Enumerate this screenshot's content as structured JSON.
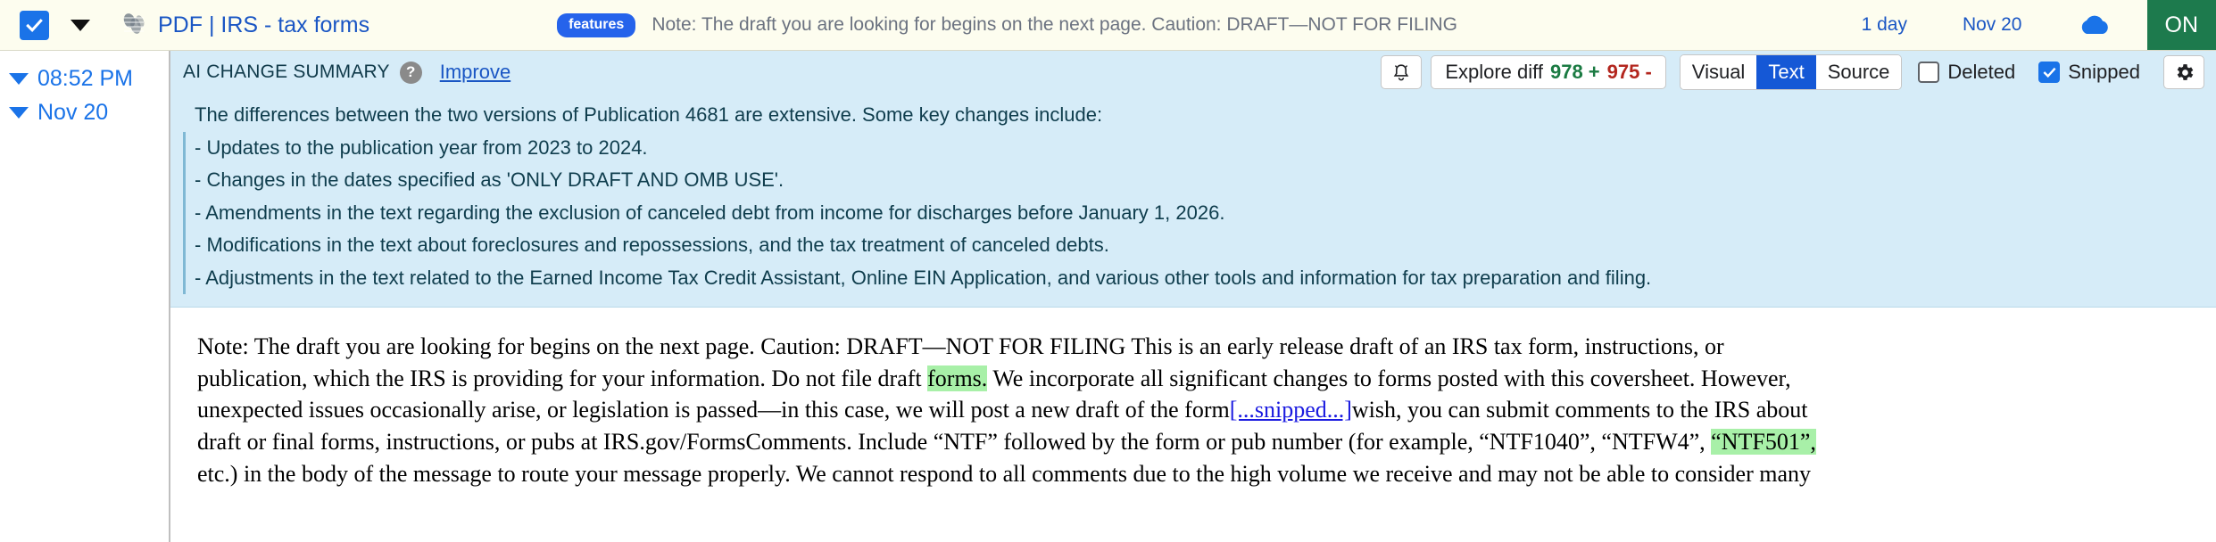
{
  "topbar": {
    "checkbox_checked": true,
    "title": "PDF | IRS - tax forms",
    "badge": "features",
    "note": "Note: The draft you are looking for begins on the next page. Caution: DRAFT—NOT FOR FILING",
    "interval": "1 day",
    "date": "Nov 20",
    "power": "ON",
    "accent_blue": "#1a73e8",
    "bg": "#fdfdef",
    "power_bg": "#1d7a4d"
  },
  "sidebar": {
    "items": [
      {
        "label": "08:52 PM"
      },
      {
        "label": "Nov 20"
      }
    ]
  },
  "summary": {
    "label": "AI CHANGE SUMMARY",
    "help": "?",
    "improve": "Improve",
    "bell_icon": "bell-icon",
    "diff": {
      "prefix": "Explore diff",
      "added": "978 +",
      "removed": "975 -",
      "added_color": "#1a7a42",
      "removed_color": "#b3261e"
    },
    "view_modes": [
      {
        "label": "Visual",
        "active": false
      },
      {
        "label": "Text",
        "active": true
      },
      {
        "label": "Source",
        "active": false
      }
    ],
    "checkboxes": [
      {
        "label": "Deleted",
        "checked": false
      },
      {
        "label": "Snipped",
        "checked": true
      }
    ],
    "gear_icon": "gear-icon",
    "lines": [
      "The differences between the two versions of Publication 4681 are extensive. Some key changes include:",
      "- Updates to the publication year from 2023 to 2024.",
      "- Changes in the dates specified as 'ONLY DRAFT AND OMB USE'.",
      "- Amendments in the text regarding the exclusion of canceled debt from income for discharges before January 1, 2026.",
      "- Modifications in the text about foreclosures and repossessions, and the tax treatment of canceled debts.",
      "- Adjustments in the text related to the Earned Income Tax Credit Assistant, Online EIN Application, and various other tools and information for tax preparation and filing."
    ],
    "panel_bg": "#d6ecf8"
  },
  "document": {
    "para_1a": "Note: The draft you are looking for begins on the next page. Caution: DRAFT—NOT FOR FILING This is an early release draft of an IRS tax form, instructions, or",
    "para_1b_pre": "publication, which the IRS is providing for your information. Do not file draft ",
    "para_1b_hl": "forms.",
    "para_1b_post": " We incorporate all significant changes to forms posted with this coversheet. However,",
    "para_1c_pre": "unexpected issues occasionally arise, or legislation is passed—in this case, we will post a new draft of the form",
    "para_1c_snip": "[...snipped...]",
    "para_1c_post": "wish, you can submit comments to the IRS about",
    "para_1d_pre": "draft or final forms, instructions, or pubs at IRS.gov/FormsComments. Include “NTF” followed by the form or pub number (for example, “NTF1040”, “NTFW4”, ",
    "para_1d_hl": "“NTF501”,",
    "para_1e": "etc.) in the body of the message to route your message properly. We cannot respond to all comments due to the high volume we receive and may not be able to consider many",
    "highlight_color": "#a8f0a8",
    "snip_color": "#1a1ae0"
  }
}
